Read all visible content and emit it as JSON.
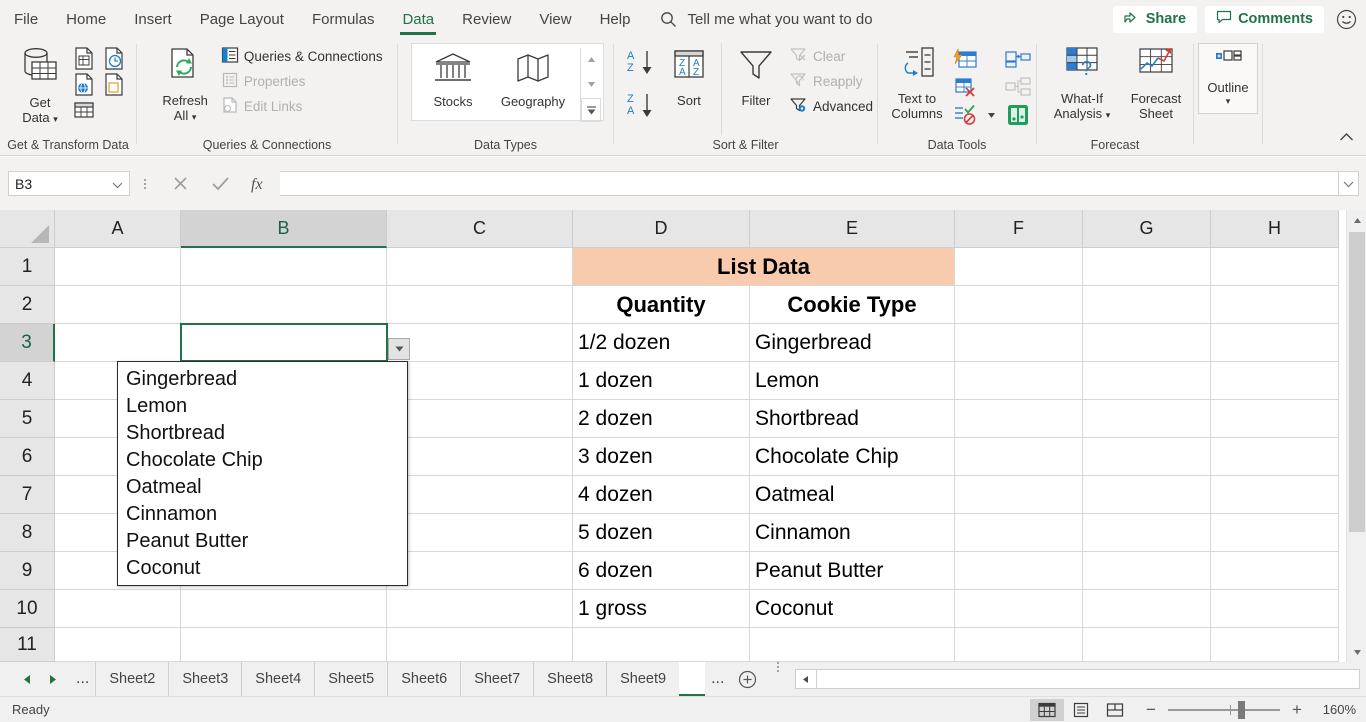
{
  "ribbon_tabs": [
    {
      "label": "File",
      "active": false
    },
    {
      "label": "Home",
      "active": false
    },
    {
      "label": "Insert",
      "active": false
    },
    {
      "label": "Page Layout",
      "active": false
    },
    {
      "label": "Formulas",
      "active": false
    },
    {
      "label": "Data",
      "active": true
    },
    {
      "label": "Review",
      "active": false
    },
    {
      "label": "View",
      "active": false
    },
    {
      "label": "Help",
      "active": false
    }
  ],
  "tellme": {
    "label": "Tell me what you want to do",
    "icon": "search-icon"
  },
  "titlebar_right": {
    "share": "Share",
    "comments": "Comments",
    "smiley_icon": "smiley-face-icon"
  },
  "ribbon_groups": {
    "get_transform": {
      "label": "Get & Transform Data",
      "get_data": "Get\nData",
      "get_data_line1": "Get",
      "get_data_line2": "Data"
    },
    "queries": {
      "label": "Queries & Connections",
      "refresh_all_line1": "Refresh",
      "refresh_all_line2": "All",
      "queries_connections": "Queries & Connections",
      "properties": "Properties",
      "edit_links": "Edit Links"
    },
    "data_types": {
      "label": "Data Types",
      "stocks": "Stocks",
      "geography": "Geography"
    },
    "sort_filter": {
      "label": "Sort & Filter",
      "sort": "Sort",
      "filter": "Filter",
      "clear": "Clear",
      "reapply": "Reapply",
      "advanced": "Advanced"
    },
    "data_tools": {
      "label": "Data Tools",
      "text_to_columns_line1": "Text to",
      "text_to_columns_line2": "Columns"
    },
    "forecast": {
      "label": "Forecast",
      "what_if_line1": "What-If",
      "what_if_line2": "Analysis",
      "forecast_line1": "Forecast",
      "forecast_line2": "Sheet"
    },
    "outline": {
      "label": "",
      "outline": "Outline"
    }
  },
  "formula_bar": {
    "name_box_value": "B3",
    "formula_value": "",
    "cancel_icon": "cancel-x-icon",
    "enter_icon": "checkmark-icon",
    "function_icon": "fx-insert-function-icon"
  },
  "grid": {
    "columns": [
      "A",
      "B",
      "C",
      "D",
      "E",
      "F",
      "G",
      "H"
    ],
    "selected_column": "B",
    "rows": [
      "1",
      "2",
      "3",
      "4",
      "5",
      "6",
      "7",
      "8",
      "9",
      "10",
      "11"
    ],
    "selected_row": "3",
    "active_cell": "B3",
    "header_banner": {
      "text": "List Data",
      "color": "#F8CBAD",
      "span": "D1:E1"
    },
    "table_headers": [
      "Quantity",
      "Cookie Type"
    ],
    "table_rows": [
      {
        "quantity": "1/2 dozen",
        "cookie": "Gingerbread"
      },
      {
        "quantity": "1 dozen",
        "cookie": "Lemon"
      },
      {
        "quantity": "2 dozen",
        "cookie": "Shortbread"
      },
      {
        "quantity": "3 dozen",
        "cookie": "Chocolate Chip"
      },
      {
        "quantity": "4 dozen",
        "cookie": "Oatmeal"
      },
      {
        "quantity": "5 dozen",
        "cookie": "Cinnamon"
      },
      {
        "quantity": "6 dozen",
        "cookie": "Peanut Butter"
      },
      {
        "quantity": "1 gross",
        "cookie": "Coconut"
      }
    ]
  },
  "dropdown": {
    "open": true,
    "items": [
      "Gingerbread",
      "Lemon",
      "Shortbread",
      "Chocolate Chip",
      "Oatmeal",
      "Cinnamon",
      "Peanut Butter",
      "Coconut"
    ]
  },
  "sheet_tabs": {
    "overflow_left": "...",
    "overflow_right": "...",
    "tabs": [
      {
        "label": "Sheet2",
        "active": false
      },
      {
        "label": "Sheet3",
        "active": false
      },
      {
        "label": "Sheet4",
        "active": false
      },
      {
        "label": "Sheet5",
        "active": false
      },
      {
        "label": "Sheet6",
        "active": false
      },
      {
        "label": "Sheet7",
        "active": false
      },
      {
        "label": "Sheet8",
        "active": false
      },
      {
        "label": "Sheet9",
        "active": false
      },
      {
        "label": "",
        "active": true
      }
    ]
  },
  "status_bar": {
    "text": "Ready",
    "views": [
      "normal-view-icon",
      "page-layout-view-icon",
      "page-break-preview-icon"
    ],
    "active_view": "normal-view-icon",
    "zoom_out": "−",
    "zoom_in": "+",
    "zoom_level": "160%"
  },
  "theme": {
    "accent_green": "#217346",
    "banner_peach": "#F8CBAD",
    "ribbon_bg": "#f3f2f1"
  }
}
